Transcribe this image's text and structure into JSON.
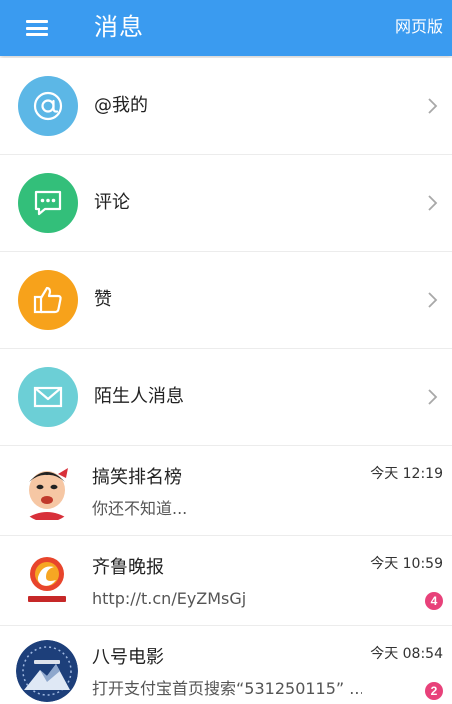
{
  "header": {
    "title": "消息",
    "web_version_label": "网页版"
  },
  "categories": [
    {
      "label": "@我的",
      "icon": "at-icon",
      "color": "#5cb7e6"
    },
    {
      "label": "评论",
      "icon": "comment-icon",
      "color": "#33bf7a"
    },
    {
      "label": "赞",
      "icon": "thumbs-up-icon",
      "color": "#f7a21b"
    },
    {
      "label": "陌生人消息",
      "icon": "envelope-icon",
      "color": "#6ccfd6"
    }
  ],
  "messages": [
    {
      "name": "搞笑排名榜",
      "preview": "你还不知道...",
      "time": "今天 12:19",
      "badge": ""
    },
    {
      "name": "齐鲁晚报",
      "preview": "http://t.cn/EyZMsGj",
      "time": "今天 10:59",
      "badge": "4"
    },
    {
      "name": "八号电影",
      "preview": "打开支付宝首页搜索“531250115” ...",
      "time": "今天 08:54",
      "badge": "2"
    }
  ],
  "colors": {
    "header_bg": "#3a9bf0",
    "badge": "#e8417a"
  }
}
